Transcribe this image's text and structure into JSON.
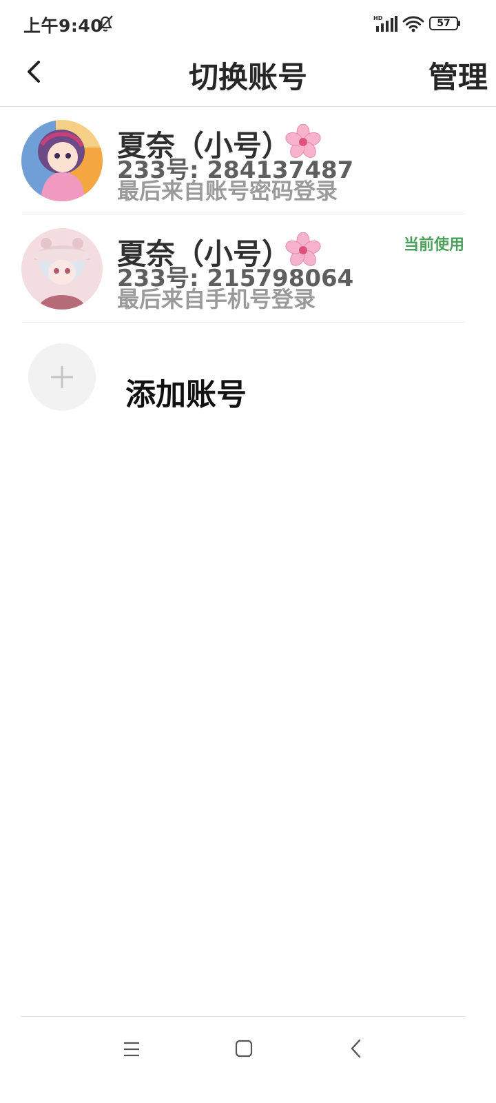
{
  "status_bar": {
    "time": "上午9:40",
    "battery": "57",
    "network_label": "HD",
    "icons": [
      "mute-bell-icon",
      "signal-icon",
      "wifi-icon",
      "battery-icon"
    ]
  },
  "header": {
    "back_icon": "chevron-left-icon",
    "title": "切换账号",
    "manage_label": "管理"
  },
  "accounts": [
    {
      "name": "夏奈（小号）",
      "id": "233号: 284137487",
      "login": "最后来自账号密码登录",
      "badge": "",
      "avatar_colors": [
        "#f4b6c6",
        "#f7d48a",
        "#6f4e8f"
      ]
    },
    {
      "name": "夏奈（小号）",
      "id": "233号: 215798064",
      "login": "最后来自手机号登录",
      "badge": "当前使用",
      "avatar_colors": [
        "#f3d3d8",
        "#d9c2c6",
        "#b56b78"
      ]
    }
  ],
  "add_account": {
    "label": "添加账号",
    "icon": "plus-icon"
  },
  "nav_bar": {
    "icons": [
      "menu-icon",
      "home-icon",
      "back-icon"
    ]
  },
  "colors": {
    "accent_green": "#4aa05a",
    "flower_pink": "#f4a6c0"
  }
}
